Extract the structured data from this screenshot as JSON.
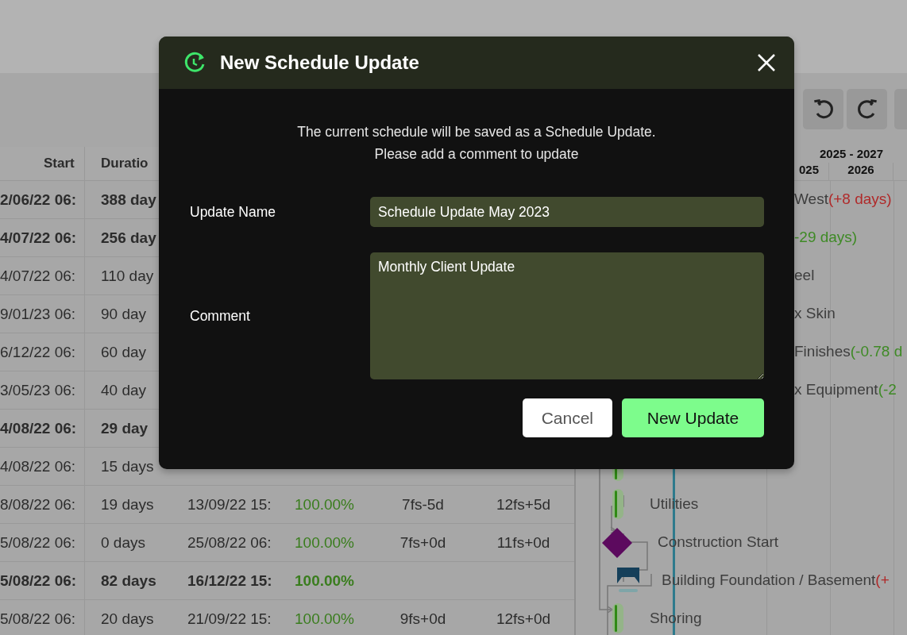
{
  "table": {
    "columns": [
      "Start",
      "Duratio"
    ],
    "rows": [
      {
        "bold": true,
        "cells": [
          "2/06/22 06:",
          "388 day"
        ]
      },
      {
        "bold": true,
        "cells": [
          "4/07/22 06:",
          "256 day"
        ]
      },
      {
        "bold": false,
        "cells": [
          "4/07/22 06:",
          "110 day"
        ]
      },
      {
        "bold": false,
        "cells": [
          "9/01/23 06:",
          "90 day"
        ]
      },
      {
        "bold": false,
        "cells": [
          "6/12/22 06:",
          "60 day"
        ]
      },
      {
        "bold": false,
        "cells": [
          "3/05/23 06:",
          "40 day"
        ]
      },
      {
        "bold": true,
        "cells": [
          "4/08/22 06:",
          "29 day"
        ]
      },
      {
        "bold": false,
        "cells": [
          "4/08/22 06:",
          "15 days"
        ]
      },
      {
        "bold": false,
        "cells": [
          "8/08/22 06:",
          "19 days",
          "13/09/22 15:",
          "100.00%",
          "7fs-5d",
          "12fs+5d"
        ]
      },
      {
        "bold": false,
        "cells": [
          "5/08/22 06:",
          "0 days",
          "25/08/22 06:",
          "100.00%",
          "7fs+0d",
          "11fs+0d"
        ]
      },
      {
        "bold": true,
        "cells": [
          "5/08/22 06:",
          "82 days",
          "16/12/22 15:",
          "100.00%"
        ]
      },
      {
        "bold": false,
        "cells": [
          "5/08/22 06:",
          "20 days",
          "21/09/22 15:",
          "100.00%",
          "9fs+0d",
          "12fs+0d"
        ]
      }
    ]
  },
  "gantt": {
    "period": "2025 - 2027",
    "years": [
      "025",
      "2026"
    ],
    "tasks_top": [
      {
        "kind": "text",
        "label": "West",
        "delta": "(+8 days)",
        "late": true
      },
      {
        "kind": "text",
        "delta": "-29 days)",
        "late": false
      },
      {
        "kind": "text",
        "label": "eel"
      },
      {
        "kind": "text",
        "label": "x Skin"
      },
      {
        "kind": "text",
        "label": "Finishes",
        "delta": "(-0.78 d",
        "late": false
      },
      {
        "kind": "text",
        "label": "x Equipment",
        "delta": "(-2",
        "late": false
      }
    ],
    "tasks_bottom": [
      {
        "kind": "task"
      },
      {
        "kind": "task",
        "label": "Utilities"
      },
      {
        "kind": "milestone",
        "label": "Construction Start"
      },
      {
        "kind": "summary",
        "label": "Building Foundation / Basement",
        "delta": "(+",
        "late": true
      },
      {
        "kind": "task",
        "label": "Shoring"
      }
    ]
  },
  "dialog": {
    "title": "New Schedule Update",
    "message": [
      "The current schedule will be saved as a Schedule Update.",
      "Please add a comment to update"
    ],
    "fields": [
      {
        "label": "Update Name",
        "kind": "input",
        "value": "Schedule Update May 2023"
      },
      {
        "label": "Comment",
        "kind": "textarea",
        "value": "Monthly Client Update"
      }
    ],
    "buttons": [
      {
        "label": "Cancel",
        "kind": "secondary"
      },
      {
        "label": "New Update",
        "kind": "primary"
      }
    ]
  }
}
